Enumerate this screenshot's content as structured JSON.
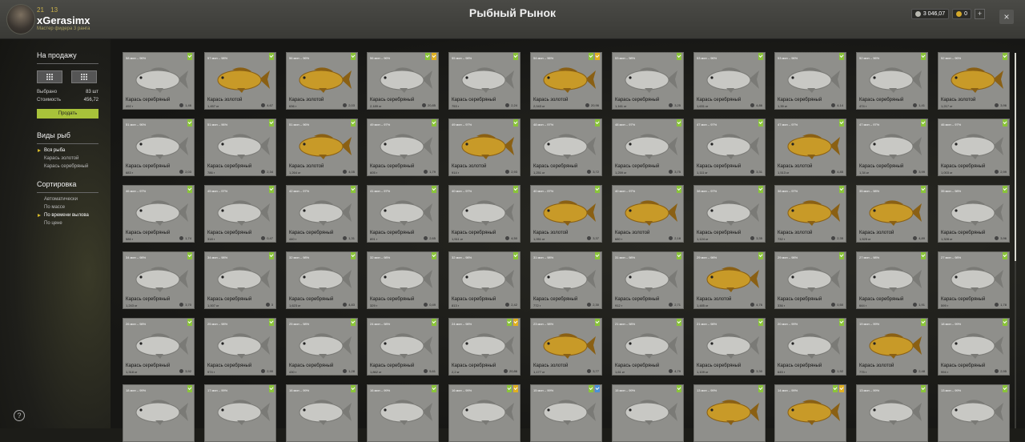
{
  "header": {
    "title": "Рыбный Рынок",
    "username": "xGerasimx",
    "subtitle": "Мастер фидера 3 ранга",
    "stat1": "21",
    "stat2": "13",
    "silver": "3 046,07",
    "gold": "0",
    "close_label": "×"
  },
  "sidebar": {
    "for_sale": "На продажу",
    "selected_label": "Выбрано",
    "selected_value": "83 шт",
    "cost_label": "Стоимость",
    "cost_value": "456,72",
    "sell_button": "Продать",
    "species_title": "Виды рыб",
    "species": [
      "Вся рыба",
      "Карась золотой",
      "Карась серебряный"
    ],
    "sort_title": "Сортировка",
    "sort_options": [
      "Автоматически",
      "По массе",
      "По времени вылова",
      "По цене"
    ],
    "help": "?"
  },
  "colors": {
    "silver_fish": "#c8c8c4",
    "gold_fish": "#c89a28",
    "badge_green": "#8ac43a",
    "badge_yellow": "#e0b020",
    "badge_blue": "#4a90d8",
    "accent": "#a8c23a"
  },
  "cards": [
    {
      "i": "58 мин – 96%",
      "n": "Карась серебряный",
      "w": "492 г",
      "p": "1,46",
      "t": "s",
      "b": [
        "g"
      ]
    },
    {
      "i": "57 мин – 98%",
      "n": "Карась золотой",
      "w": "1,457 кг",
      "p": "4,67",
      "t": "g",
      "b": [
        "g"
      ]
    },
    {
      "i": "56 мин – 96%",
      "n": "Карась золотой",
      "w": "636 г",
      "p": "2,03",
      "t": "g",
      "b": [
        "g"
      ]
    },
    {
      "i": "56 мин – 96%",
      "n": "Карась серебряный",
      "w": "2,189 кг",
      "p": "20,85",
      "t": "s",
      "b": [
        "g",
        "y"
      ]
    },
    {
      "i": "55 мин – 98%",
      "n": "Карась серебряный",
      "w": "753 г",
      "p": "2,24",
      "t": "s",
      "b": [
        "g"
      ]
    },
    {
      "i": "54 мин – 96%",
      "n": "Карась золотой",
      "w": "2,043 кг",
      "p": "20,96",
      "t": "g",
      "b": [
        "g",
        "y"
      ]
    },
    {
      "i": "53 мин – 98%",
      "n": "Карась серебряный",
      "w": "1,161 кг",
      "p": "3,25",
      "t": "s",
      "b": [
        "g"
      ]
    },
    {
      "i": "53 мин – 96%",
      "n": "Карась серебряный",
      "w": "1,631 кг",
      "p": "4,86",
      "t": "s",
      "b": [
        "g"
      ]
    },
    {
      "i": "53 мин – 96%",
      "n": "Карась серебряный",
      "w": "1,39 кг",
      "p": "4,14",
      "t": "s",
      "b": [
        "g"
      ]
    },
    {
      "i": "52 мин – 96%",
      "n": "Карась серебряный",
      "w": "474 г",
      "p": "1,41",
      "t": "s",
      "b": [
        "g"
      ]
    },
    {
      "i": "52 мин – 96%",
      "n": "Карась золотой",
      "w": "1,217 кг",
      "p": "3,96",
      "t": "g",
      "b": [
        "g"
      ]
    },
    {
      "i": "51 мин – 96%",
      "n": "Карась серебряный",
      "w": "683 г",
      "p": "2,03",
      "t": "s",
      "b": [
        "g"
      ]
    },
    {
      "i": "51 мин – 96%",
      "n": "Карась серебряный",
      "w": "786 г",
      "p": "2,34",
      "t": "s",
      "b": [
        "g"
      ]
    },
    {
      "i": "51 мин – 96%",
      "n": "Карась золотой",
      "w": "1,264 кг",
      "p": "4,05",
      "t": "g",
      "b": [
        "g"
      ]
    },
    {
      "i": "49 мин – 97%",
      "n": "Карась серебряный",
      "w": "605 г",
      "p": "1,79",
      "t": "s",
      "b": [
        "g"
      ]
    },
    {
      "i": "49 мин – 97%",
      "n": "Карась золотой",
      "w": "914 г",
      "p": "2,93",
      "t": "g",
      "b": [
        "g"
      ]
    },
    {
      "i": "48 мин – 97%",
      "n": "Карась серебряный",
      "w": "1,251 кг",
      "p": "3,72",
      "t": "s",
      "b": [
        "g"
      ]
    },
    {
      "i": "48 мин – 97%",
      "n": "Карась серебряный",
      "w": "1,259 кг",
      "p": "3,75",
      "t": "s",
      "b": [
        "g"
      ]
    },
    {
      "i": "47 мин – 97%",
      "n": "Карась серебряный",
      "w": "1,111 кг",
      "p": "3,31",
      "t": "s",
      "b": [
        "g"
      ]
    },
    {
      "i": "47 мин – 97%",
      "n": "Карась золотой",
      "w": "1,513 кг",
      "p": "4,85",
      "t": "g",
      "b": [
        "g"
      ]
    },
    {
      "i": "47 мин – 97%",
      "n": "Карась серебряный",
      "w": "1,34 кг",
      "p": "3,99",
      "t": "s",
      "b": [
        "g"
      ]
    },
    {
      "i": "46 мин – 97%",
      "n": "Карась серебряный",
      "w": "1,003 кг",
      "p": "2,99",
      "t": "s",
      "b": [
        "g"
      ]
    },
    {
      "i": "46 мин – 97%",
      "n": "Карась серебряный",
      "w": "586 г",
      "p": "1,74",
      "t": "s",
      "b": [
        "g"
      ]
    },
    {
      "i": "45 мин – 97%",
      "n": "Карась серебряный",
      "w": "318 г",
      "p": "0,47",
      "t": "s",
      "b": [
        "g"
      ]
    },
    {
      "i": "42 мин – 97%",
      "n": "Карась серебряный",
      "w": "440 г",
      "p": "1,31",
      "t": "s",
      "b": [
        "g"
      ]
    },
    {
      "i": "41 мин – 97%",
      "n": "Карась серебряный",
      "w": "891 г",
      "p": "2,65",
      "t": "s",
      "b": [
        "g"
      ]
    },
    {
      "i": "40 мин – 97%",
      "n": "Карась серебряный",
      "w": "1,511 кг",
      "p": "4,50",
      "t": "s",
      "b": [
        "g"
      ]
    },
    {
      "i": "40 мин – 97%",
      "n": "Карась золотой",
      "w": "1,051 кг",
      "p": "3,37",
      "t": "g",
      "b": [
        "g"
      ]
    },
    {
      "i": "40 мин – 97%",
      "n": "Карась золотой",
      "w": "680 г",
      "p": "2,18",
      "t": "g",
      "b": [
        "g"
      ]
    },
    {
      "i": "38 мин – 97%",
      "n": "Карась серебряный",
      "w": "1,124 кг",
      "p": "3,35",
      "t": "s",
      "b": [
        "g"
      ]
    },
    {
      "i": "38 мин – 97%",
      "n": "Карась золотой",
      "w": "732 г",
      "p": "2,35",
      "t": "g",
      "b": [
        "g"
      ]
    },
    {
      "i": "35 мин – 98%",
      "n": "Карась золотой",
      "w": "1,525 кг",
      "p": "4,89",
      "t": "g",
      "b": [
        "g"
      ]
    },
    {
      "i": "35 мин – 98%",
      "n": "Карась серебряный",
      "w": "1,328 кг",
      "p": "3,96",
      "t": "s",
      "b": [
        "g"
      ]
    },
    {
      "i": "34 мин – 98%",
      "n": "Карась серебряный",
      "w": "1,243 кг",
      "p": "3,70",
      "t": "s",
      "b": [
        "g"
      ]
    },
    {
      "i": "34 мин – 98%",
      "n": "Карась серебряный",
      "w": "1,007 кг",
      "p": "3",
      "t": "s",
      "b": [
        "g"
      ]
    },
    {
      "i": "32 мин – 98%",
      "n": "Карась серебряный",
      "w": "1,623 кг",
      "p": "4,83",
      "t": "s",
      "b": [
        "g"
      ]
    },
    {
      "i": "32 мин – 98%",
      "n": "Карась серебряный",
      "w": "329 г",
      "p": "0,49",
      "t": "s",
      "b": [
        "g"
      ]
    },
    {
      "i": "32 мин – 98%",
      "n": "Карась серебряный",
      "w": "813 г",
      "p": "2,42",
      "t": "s",
      "b": [
        "g"
      ]
    },
    {
      "i": "31 мин – 98%",
      "n": "Карась серебряный",
      "w": "772 г",
      "p": "2,30",
      "t": "s",
      "b": [
        "g"
      ]
    },
    {
      "i": "31 мин – 98%",
      "n": "Карась серебряный",
      "w": "912 г",
      "p": "2,71",
      "t": "s",
      "b": [
        "g"
      ]
    },
    {
      "i": "29 мин – 98%",
      "n": "Карась золотой",
      "w": "1,485 кг",
      "p": "4,76",
      "t": "g",
      "b": [
        "g"
      ]
    },
    {
      "i": "29 мин – 98%",
      "n": "Карась серебряный",
      "w": "336 г",
      "p": "0,50",
      "t": "s",
      "b": [
        "g"
      ]
    },
    {
      "i": "27 мин – 98%",
      "n": "Карась серебряный",
      "w": "644 г",
      "p": "1,91",
      "t": "s",
      "b": [
        "g"
      ]
    },
    {
      "i": "27 мин – 98%",
      "n": "Карась серебряный",
      "w": "599 г",
      "p": "1,78",
      "t": "s",
      "b": [
        "g"
      ]
    },
    {
      "i": "26 мин – 98%",
      "n": "Карась серебряный",
      "w": "1,318 кг",
      "p": "3,92",
      "t": "s",
      "b": [
        "g"
      ]
    },
    {
      "i": "25 мин – 98%",
      "n": "Карась серебряный",
      "w": "974 г",
      "p": "2,90",
      "t": "s",
      "b": [
        "g"
      ]
    },
    {
      "i": "25 мин – 98%",
      "n": "Карась серебряный",
      "w": "430 г",
      "p": "1,28",
      "t": "s",
      "b": [
        "g"
      ]
    },
    {
      "i": "24 мин – 98%",
      "n": "Карась серебряный",
      "w": "1,862 кг",
      "p": "5,61",
      "t": "s",
      "b": [
        "g"
      ]
    },
    {
      "i": "24 мин – 98%",
      "n": "Карась серебряный",
      "w": "2,2 кг",
      "p": "20,86",
      "t": "s",
      "b": [
        "g",
        "y"
      ]
    },
    {
      "i": "23 мин – 98%",
      "n": "Карась золотой",
      "w": "1,177 кг",
      "p": "3,77",
      "t": "g",
      "b": [
        "g"
      ]
    },
    {
      "i": "21 мин – 98%",
      "n": "Карась серебряный",
      "w": "1,61 кг",
      "p": "4,79",
      "t": "s",
      "b": [
        "g"
      ]
    },
    {
      "i": "21 мин – 98%",
      "n": "Карась серебряный",
      "w": "1,109 кг",
      "p": "3,30",
      "t": "s",
      "b": [
        "g"
      ]
    },
    {
      "i": "20 мин – 99%",
      "n": "Карась серебряный",
      "w": "645 г",
      "p": "1,92",
      "t": "s",
      "b": [
        "g"
      ]
    },
    {
      "i": "19 мин – 99%",
      "n": "Карась золотой",
      "w": "775 г",
      "p": "2,48",
      "t": "g",
      "b": [
        "g"
      ]
    },
    {
      "i": "18 мин – 99%",
      "n": "Карась серебряный",
      "w": "994 г",
      "p": "2,95",
      "t": "s",
      "b": [
        "g"
      ]
    },
    {
      "i": "18 мин – 99%",
      "n": "",
      "w": "",
      "p": "",
      "t": "s",
      "b": [
        "g"
      ]
    },
    {
      "i": "17 мин – 99%",
      "n": "",
      "w": "",
      "p": "",
      "t": "s",
      "b": [
        "g"
      ]
    },
    {
      "i": "16 мин – 99%",
      "n": "",
      "w": "",
      "p": "",
      "t": "s",
      "b": [
        "g"
      ]
    },
    {
      "i": "16 мин – 99%",
      "n": "",
      "w": "",
      "p": "",
      "t": "s",
      "b": [
        "g"
      ]
    },
    {
      "i": "16 мин – 99%",
      "n": "",
      "w": "",
      "p": "",
      "t": "s",
      "b": [
        "g",
        "y"
      ]
    },
    {
      "i": "15 мин – 99%",
      "n": "",
      "w": "",
      "p": "",
      "t": "s",
      "b": [
        "g",
        "b"
      ]
    },
    {
      "i": "15 мин – 99%",
      "n": "",
      "w": "",
      "p": "",
      "t": "s",
      "b": [
        "g"
      ]
    },
    {
      "i": "13 мин – 99%",
      "n": "",
      "w": "",
      "p": "",
      "t": "g",
      "b": [
        "g"
      ]
    },
    {
      "i": "14 мин – 99%",
      "n": "",
      "w": "",
      "p": "",
      "t": "g",
      "b": [
        "g",
        "y"
      ]
    },
    {
      "i": "13 мин – 99%",
      "n": "",
      "w": "",
      "p": "",
      "t": "s",
      "b": [
        "g"
      ]
    },
    {
      "i": "13 мин – 99%",
      "n": "",
      "w": "",
      "p": "",
      "t": "s",
      "b": [
        "g"
      ]
    }
  ]
}
